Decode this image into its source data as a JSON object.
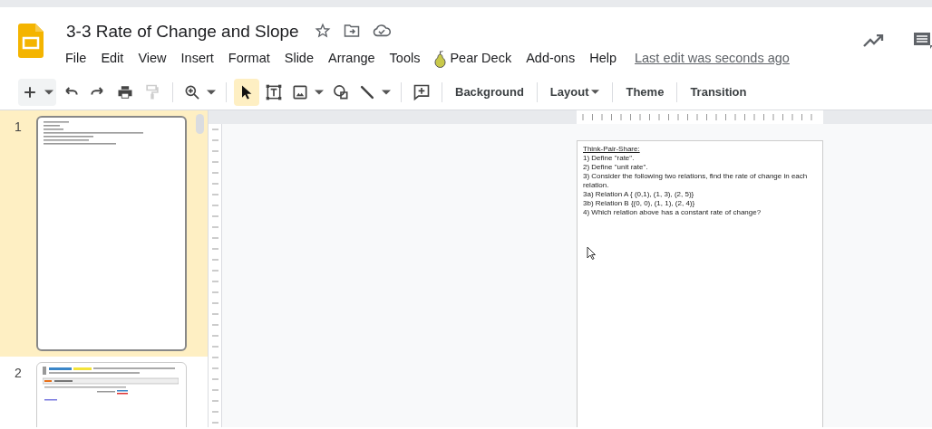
{
  "document": {
    "title": "3-3 Rate of Change and Slope"
  },
  "menu": [
    {
      "label": "File",
      "kind": "plain"
    },
    {
      "label": "Edit",
      "kind": "plain"
    },
    {
      "label": "View",
      "kind": "plain"
    },
    {
      "label": "Insert",
      "kind": "plain"
    },
    {
      "label": "Format",
      "kind": "plain"
    },
    {
      "label": "Slide",
      "kind": "plain"
    },
    {
      "label": "Arrange",
      "kind": "plain"
    },
    {
      "label": "Tools",
      "kind": "plain"
    },
    {
      "label": "Pear Deck",
      "kind": "addon"
    },
    {
      "label": "Add-ons",
      "kind": "plain"
    },
    {
      "label": "Help",
      "kind": "plain"
    }
  ],
  "last_edit": "Last edit was seconds ago",
  "tools": [
    {
      "kind": "new",
      "dropdown": true,
      "selected": false,
      "disabled": false
    },
    {
      "kind": "undo",
      "dropdown": false,
      "selected": false,
      "disabled": false
    },
    {
      "kind": "redo",
      "dropdown": false,
      "selected": false,
      "disabled": false
    },
    {
      "kind": "print",
      "dropdown": false,
      "selected": false,
      "disabled": false
    },
    {
      "kind": "paint",
      "dropdown": false,
      "selected": false,
      "disabled": true
    },
    {
      "kind": "zoom",
      "dropdown": true,
      "selected": false,
      "disabled": false
    },
    {
      "kind": "select",
      "dropdown": false,
      "selected": true,
      "disabled": false
    },
    {
      "kind": "textbox",
      "dropdown": false,
      "selected": false,
      "disabled": false
    },
    {
      "kind": "image",
      "dropdown": true,
      "selected": false,
      "disabled": false
    },
    {
      "kind": "shape",
      "dropdown": false,
      "selected": false,
      "disabled": false
    },
    {
      "kind": "line",
      "dropdown": true,
      "selected": false,
      "disabled": false
    },
    {
      "kind": "comment",
      "dropdown": false,
      "selected": false,
      "disabled": false
    }
  ],
  "text_buttons": [
    {
      "label": "Background",
      "dropdown": false
    },
    {
      "label": "Layout",
      "dropdown": true
    },
    {
      "label": "Theme",
      "dropdown": false
    },
    {
      "label": "Transition",
      "dropdown": false
    }
  ],
  "slides": [
    {
      "number": "1",
      "selected": true,
      "kind": "text"
    },
    {
      "number": "2",
      "selected": false,
      "kind": "concept"
    }
  ],
  "slide_lines": [
    {
      "text": "Think-Pair-Share:",
      "underline": true
    },
    {
      "text": "1) Define \"rate\".",
      "underline": false
    },
    {
      "text": "2) Define \"unit rate\".",
      "underline": false
    },
    {
      "text": "3) Consider the following two relations, find the rate of change in each relation.",
      "underline": false
    },
    {
      "text": "3a) Relation A { (0,1), (1, 3), (2, 5)}",
      "underline": false
    },
    {
      "text": "3b) Relation B {(0, 0), (1, 1), (2, 4)}",
      "underline": false
    },
    {
      "text": "4) Which relation above has a constant rate of change?",
      "underline": false
    }
  ]
}
